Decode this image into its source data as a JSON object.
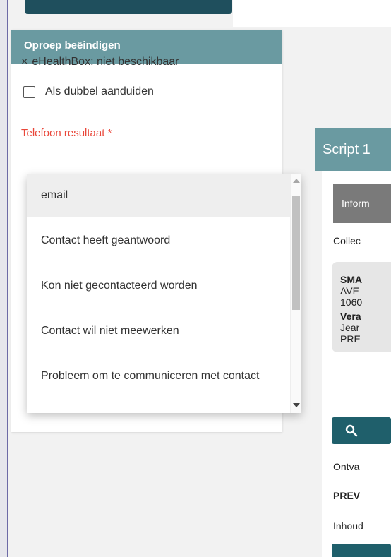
{
  "panel": {
    "title": "Oproep beëindigen",
    "ehealth_icon": "×",
    "ehealth_text": "eHealthBox: niet beschikbaar",
    "checkbox_label": "Als dubbel aanduiden",
    "phone_result_label": "Telefoon resultaat *"
  },
  "dropdown": {
    "options": [
      "email",
      "Contact heeft geantwoord",
      "Kon niet gecontacteerd worden",
      "Contact wil niet meewerken",
      "Probleem om te communiceren met contact"
    ],
    "selected_index": 0
  },
  "right": {
    "script_title": "Script 1",
    "info_bar": "Inform",
    "collect": "Collec",
    "addr_l1": "SMA",
    "addr_l2": "AVE",
    "addr_l3": "1060",
    "addr_l4": "Vera",
    "addr_l5": "Jear",
    "addr_l6": "PRE",
    "search_icon": "search-icon",
    "received": "Ontva",
    "prev": "PREV",
    "content": "Inhoud"
  },
  "colors": {
    "header_teal": "#6a9aa1",
    "dark_teal": "#1f5f6b",
    "required_red": "#e9473a"
  }
}
